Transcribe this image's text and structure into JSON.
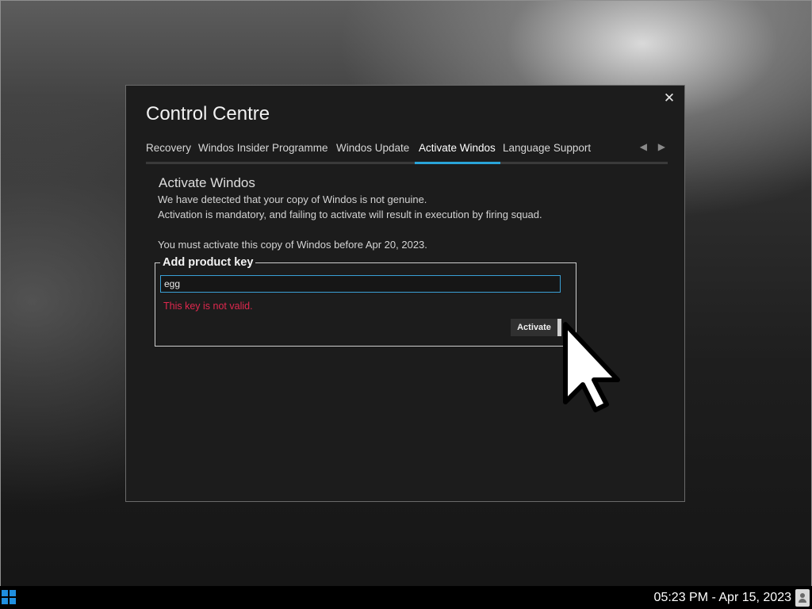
{
  "window": {
    "title": "Control Centre",
    "close_glyph": "✕"
  },
  "tabs": [
    {
      "label": "Recovery"
    },
    {
      "label": "Windos Insider Programme"
    },
    {
      "label": "Windos Update"
    },
    {
      "label": "Activate Windos",
      "active": true
    },
    {
      "label": "Language Support"
    }
  ],
  "tab_nav": {
    "prev": "◀",
    "next": "▶"
  },
  "activation": {
    "heading": "Activate Windos",
    "line1": "We have detected that your copy of Windos is not genuine.",
    "line2": "Activation is mandatory, and failing to activate will result in execution by firing squad.",
    "deadline": "You must activate this copy of Windos before Apr 20, 2023."
  },
  "product_key": {
    "legend": "Add product key",
    "value": "egg",
    "error": "This key is not valid.",
    "activate_label": "Activate"
  },
  "taskbar": {
    "clock": "05:23 PM - Apr 15, 2023"
  },
  "colors": {
    "accent": "#2aa4d8",
    "error": "#e0284e",
    "start_icon": "#1f8fe0"
  }
}
